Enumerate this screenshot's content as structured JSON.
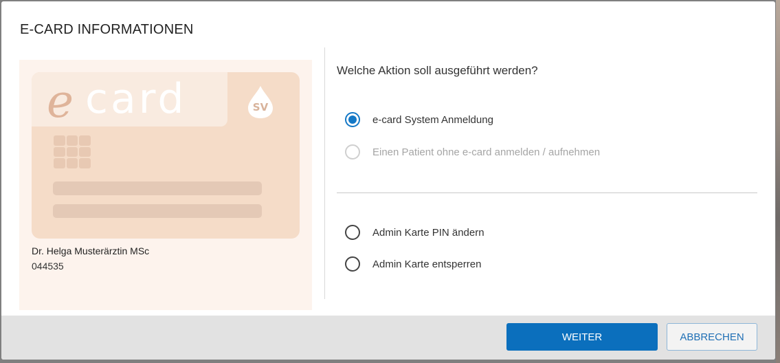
{
  "dialog": {
    "title": "E-CARD INFORMATIONEN"
  },
  "card": {
    "logo_e": "e",
    "logo_card": "card",
    "sv_logo": "SV",
    "holder_name": "Dr. Helga Musterärztin MSc",
    "holder_id": "044535"
  },
  "actions": {
    "question": "Welche Aktion soll ausgeführt werden?",
    "options": [
      {
        "label": "e-card System Anmeldung",
        "selected": true,
        "disabled": false
      },
      {
        "label": "Einen Patient ohne e-card anmelden / aufnehmen",
        "selected": false,
        "disabled": true
      },
      {
        "label": "Admin Karte PIN ändern",
        "selected": false,
        "disabled": false
      },
      {
        "label": "Admin Karte entsperren",
        "selected": false,
        "disabled": false
      }
    ]
  },
  "footer": {
    "primary_label": "WEITER",
    "secondary_label": "ABBRECHEN"
  },
  "colors": {
    "accent": "#0b6fbd",
    "card_background": "#f5dcc8",
    "panel_background": "#fdf3ed"
  }
}
